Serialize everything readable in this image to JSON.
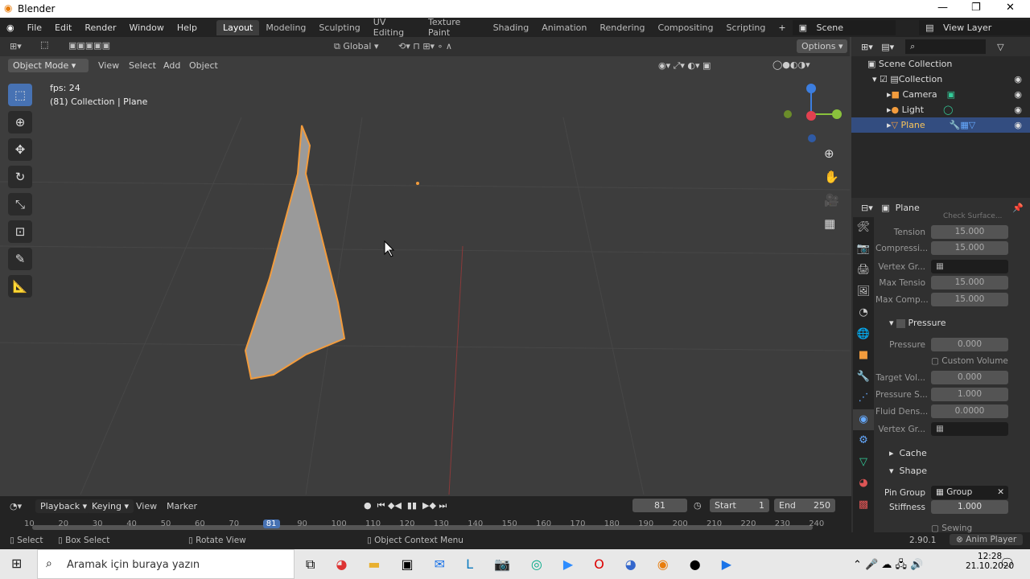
{
  "window": {
    "title": "Blender",
    "min": "—",
    "max": "❐",
    "close": "✕"
  },
  "menu": [
    "File",
    "Edit",
    "Render",
    "Window",
    "Help"
  ],
  "workspaces": [
    "Layout",
    "Modeling",
    "Sculpting",
    "UV Editing",
    "Texture Paint",
    "Shading",
    "Animation",
    "Rendering",
    "Compositing",
    "Scripting"
  ],
  "active_workspace": "Layout",
  "scene": "Scene",
  "view_layer": "View Layer",
  "viewport": {
    "mode": "Object Mode",
    "menus": [
      "View",
      "Select",
      "Add",
      "Object"
    ],
    "orientation": "Global",
    "options": "Options",
    "fps": "fps: 24",
    "info": "(81) Collection | Plane"
  },
  "outliner": {
    "root": "Scene Collection",
    "items": [
      {
        "name": "Collection"
      },
      {
        "name": "Camera"
      },
      {
        "name": "Light"
      },
      {
        "name": "Plane",
        "selected": true
      }
    ]
  },
  "properties": {
    "object": "Plane",
    "header_partial": "Check Surface...",
    "rows": [
      {
        "label": "Tension",
        "value": "15.000"
      },
      {
        "label": "Compressi...",
        "value": "15.000"
      },
      {
        "label": "Vertex Gr...",
        "value": ""
      },
      {
        "label": "Max Tensio",
        "value": "15.000"
      },
      {
        "label": "Max Comp...",
        "value": "15.000"
      }
    ],
    "pressure_panel": "Pressure",
    "pressure_rows": [
      {
        "label": "Pressure",
        "value": "0.000"
      },
      {
        "label": "Target Vol...",
        "value": "0.000"
      },
      {
        "label": "Pressure S...",
        "value": "1.000"
      },
      {
        "label": "Fluid Dens...",
        "value": "0.0000"
      },
      {
        "label": "Vertex Gr...",
        "value": ""
      }
    ],
    "custom_volume": "Custom Volume",
    "cache_panel": "Cache",
    "shape_panel": "Shape",
    "pin_group_label": "Pin Group",
    "pin_group_value": "Group",
    "stiffness_label": "Stiffness",
    "stiffness_value": "1.000",
    "sewing": "Sewing"
  },
  "timeline": {
    "menus": [
      "Playback",
      "Keying",
      "View",
      "Marker"
    ],
    "current_frame": "81",
    "start_label": "Start",
    "start": "1",
    "end_label": "End",
    "end": "250",
    "ticks": [
      "10",
      "20",
      "30",
      "40",
      "50",
      "60",
      "70",
      "81",
      "90",
      "100",
      "110",
      "120",
      "130",
      "140",
      "150",
      "160",
      "170",
      "180",
      "190",
      "200",
      "210",
      "220",
      "230",
      "240"
    ]
  },
  "status": {
    "select": "Select",
    "box_select": "Box Select",
    "rotate": "Rotate View",
    "context": "Object Context Menu",
    "version": "2.90.1",
    "anim_player": "Anim Player"
  },
  "taskbar": {
    "search_placeholder": "Aramak için buraya yazın",
    "time": "12:28",
    "date": "21.10.2020"
  },
  "colors": {
    "accent": "#4772b3",
    "selection": "#f39c3d",
    "bg": "#3d3d3d"
  }
}
